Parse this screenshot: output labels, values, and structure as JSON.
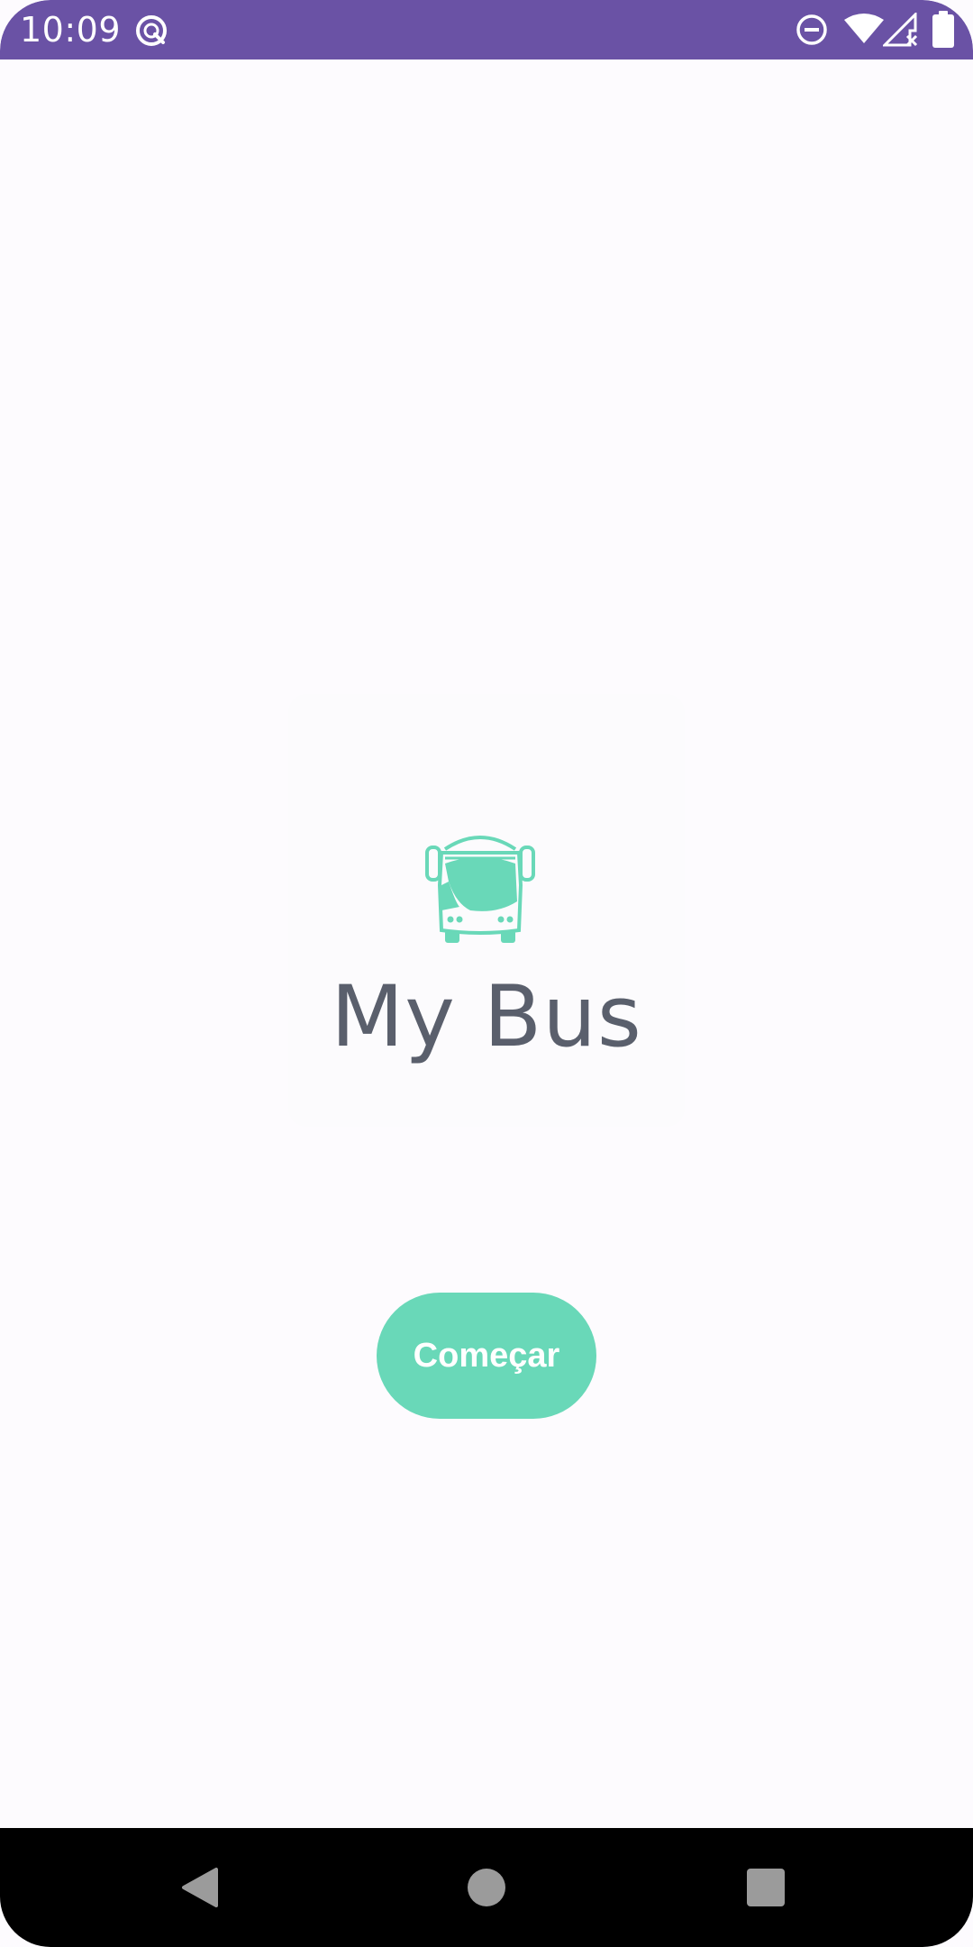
{
  "status_bar": {
    "time": "10:09",
    "background_color": "#6a52a5",
    "icons": [
      "sync-icon",
      "do-not-disturb-icon",
      "wifi-icon",
      "signal-no-data-icon",
      "battery-icon"
    ]
  },
  "app": {
    "title": "My Bus",
    "logo_icon": "bus-icon",
    "accent_color": "#69d8b8",
    "title_color": "#5a5f6c"
  },
  "actions": {
    "start_label": "Começar"
  },
  "nav_bar": {
    "buttons": [
      "back-icon",
      "home-icon",
      "recents-icon"
    ]
  }
}
